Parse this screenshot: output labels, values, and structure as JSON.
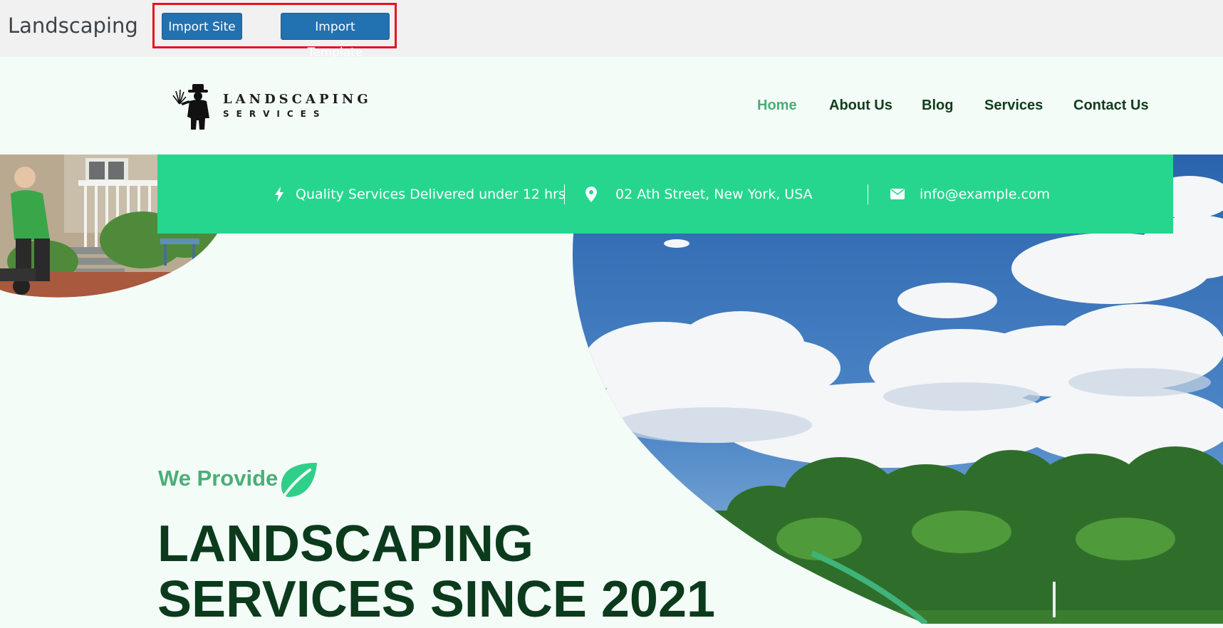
{
  "admin": {
    "title": "Landscaping",
    "import_site_label": "Import Site",
    "import_template_label": "Import Template",
    "highlight_color": "#e8121f",
    "button_color": "#2271b1"
  },
  "site": {
    "logo": {
      "line1": "LANDSCAPING",
      "line2": "SERVICES",
      "icon": "farmer-silhouette-icon"
    },
    "nav": [
      {
        "label": "Home",
        "active": true
      },
      {
        "label": "About Us"
      },
      {
        "label": "Blog"
      },
      {
        "label": "Services"
      },
      {
        "label": "Contact Us"
      }
    ],
    "info_bar": {
      "color": "#26d68f",
      "items": [
        {
          "icon": "bolt-icon",
          "text": "Quality Services Delivered under 12 hrs"
        },
        {
          "icon": "map-pin-icon",
          "text": "02 Ath Street, New York, USA"
        },
        {
          "icon": "envelope-icon",
          "text": "info@example.com"
        }
      ]
    },
    "hero": {
      "eyebrow": "We Provide",
      "eyebrow_icon": "leaf-icon",
      "headline_line1": "LANDSCAPING",
      "headline_line2": "SERVICES SINCE 2021",
      "accent_color": "#4aae77",
      "headline_color": "#0b3b1c"
    }
  }
}
